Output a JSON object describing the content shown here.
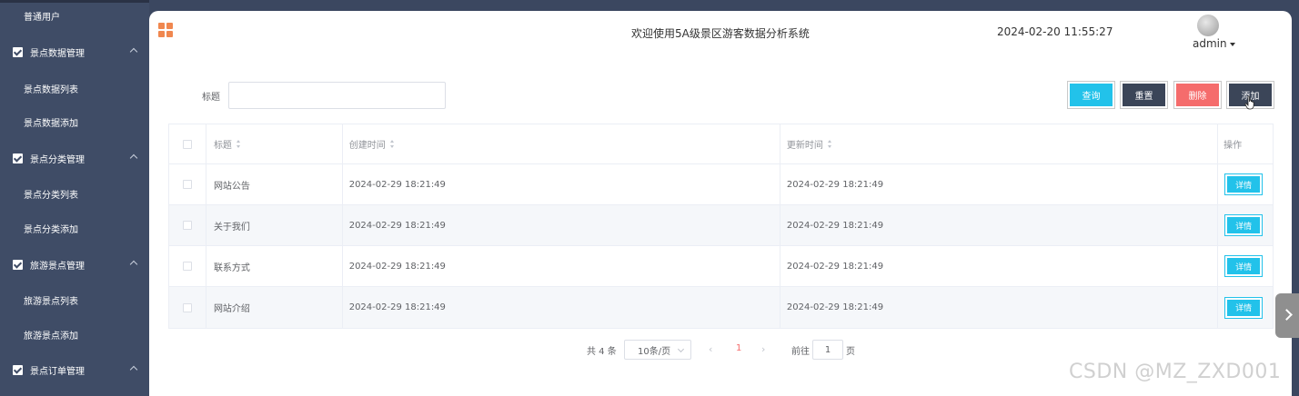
{
  "sidebar": {
    "top_item": "普通用户",
    "groups": [
      {
        "label": "景点数据管理",
        "items": [
          "景点数据列表",
          "景点数据添加"
        ]
      },
      {
        "label": "景点分类管理",
        "items": [
          "景点分类列表",
          "景点分类添加"
        ]
      },
      {
        "label": "旅游景点管理",
        "items": [
          "旅游景点列表",
          "旅游景点添加"
        ]
      },
      {
        "label": "景点订单管理",
        "items": []
      }
    ]
  },
  "header": {
    "title": "欢迎使用5A级景区游客数据分析系统",
    "datetime": "2024-02-20 11:55:27",
    "user": "admin"
  },
  "search": {
    "label": "标题",
    "value": ""
  },
  "actions": {
    "query": "查询",
    "reset": "重置",
    "delete": "删除",
    "add": "添加"
  },
  "table": {
    "columns": [
      "标题",
      "创建时间",
      "更新时间",
      "操作"
    ],
    "detail_label": "详情",
    "rows": [
      {
        "title": "网站公告",
        "created": "2024-02-29 18:21:49",
        "updated": "2024-02-29 18:21:49"
      },
      {
        "title": "关于我们",
        "created": "2024-02-29 18:21:49",
        "updated": "2024-02-29 18:21:49"
      },
      {
        "title": "联系方式",
        "created": "2024-02-29 18:21:49",
        "updated": "2024-02-29 18:21:49"
      },
      {
        "title": "网站介绍",
        "created": "2024-02-29 18:21:49",
        "updated": "2024-02-29 18:21:49"
      }
    ]
  },
  "pagination": {
    "total": "共 4 条",
    "page_size": "10条/页",
    "current_page": "1",
    "goto_label": "前往",
    "goto_value": "1",
    "page_suffix": "页"
  },
  "watermark": "CSDN @MZ_ZXD001",
  "colors": {
    "sidebar_bg": "#3f4c66",
    "accent_cyan": "#22c2ea",
    "dark_button": "#3b4558",
    "danger": "#f56c6c",
    "menu_icon": "#f0874f"
  }
}
